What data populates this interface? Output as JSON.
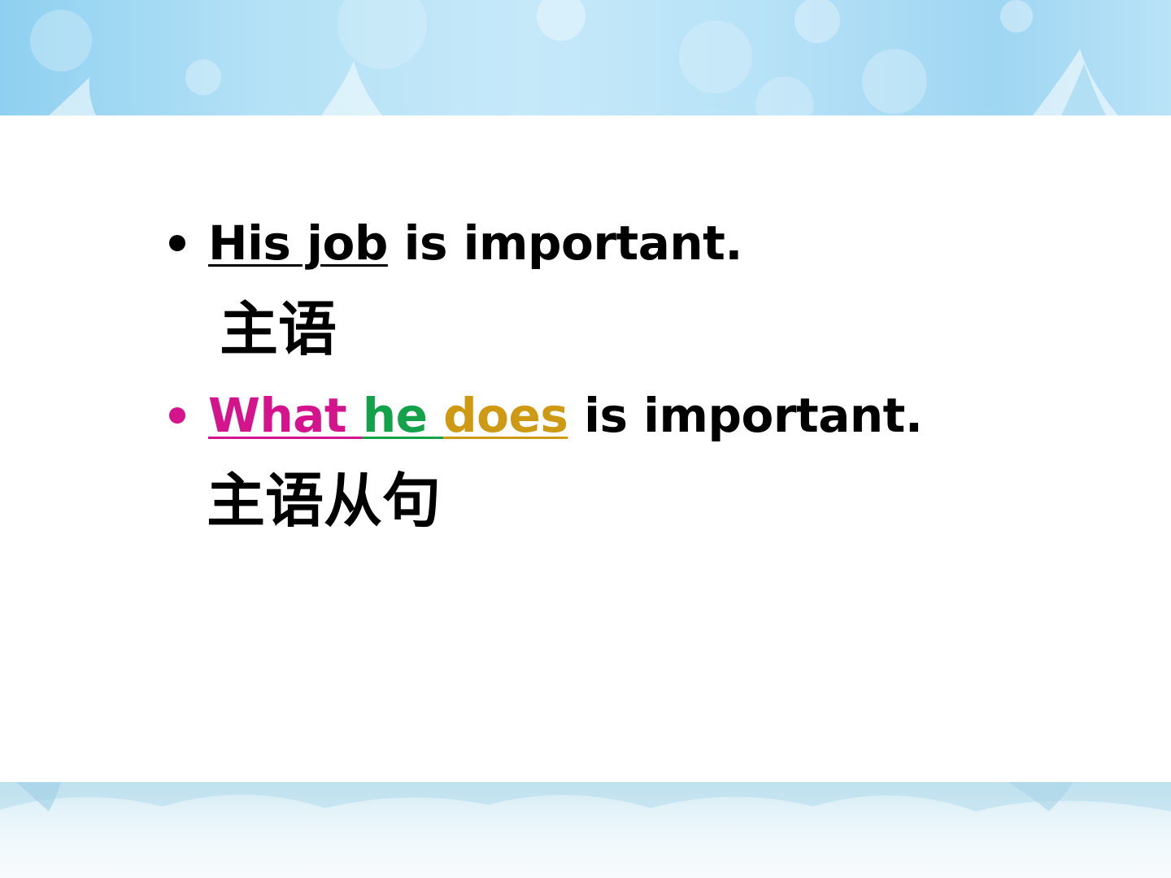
{
  "slide": {
    "colors": {
      "text": "#000000",
      "pink": "#d4148c",
      "green": "#13a24a",
      "gold": "#cf9a13",
      "banner_blue": "#a9dcf5"
    },
    "items": [
      {
        "bullet_color": "#000000",
        "segments": [
          {
            "text": "His job",
            "color": "#000000",
            "underline": true
          },
          {
            "text": " is important.",
            "color": "#000000",
            "underline": false
          }
        ],
        "label": "主语"
      },
      {
        "bullet_color": "#d4148c",
        "segments": [
          {
            "text": "What ",
            "color": "#d4148c",
            "underline": true
          },
          {
            "text": "he ",
            "color": "#13a24a",
            "underline": true
          },
          {
            "text": "does",
            "color": "#cf9a13",
            "underline": true
          },
          {
            "text": " is important.",
            "color": "#000000",
            "underline": false
          }
        ],
        "label": "主语从句"
      }
    ]
  }
}
